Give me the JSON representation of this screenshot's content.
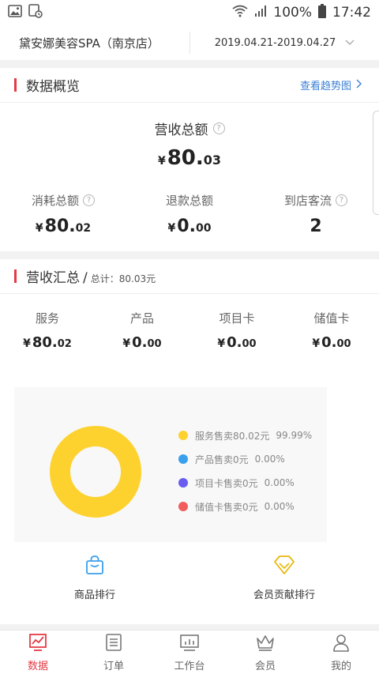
{
  "status_bar": {
    "battery": "100%",
    "time": "17:42"
  },
  "header": {
    "store_name": "黛安娜美容SPA（南京店）",
    "date_range": "2019.04.21-2019.04.27"
  },
  "overview": {
    "title": "数据概览",
    "trend_link": "查看趋势图",
    "revenue": {
      "label": "营收总额",
      "currency": "¥",
      "int": "80.",
      "dec": "03"
    },
    "consumption": {
      "label": "消耗总额",
      "currency": "¥",
      "int": "80.",
      "dec": "02"
    },
    "refund": {
      "label": "退款总额",
      "currency": "¥",
      "int": "0.",
      "dec": "00"
    },
    "visitors": {
      "label": "到店客流",
      "value": "2"
    }
  },
  "summary": {
    "title": "营收汇总",
    "slash": "/",
    "total_text": "总计：80.03元",
    "categories": [
      {
        "label": "服务",
        "currency": "¥",
        "int": "80.",
        "dec": "02"
      },
      {
        "label": "产品",
        "currency": "¥",
        "int": "0.",
        "dec": "00"
      },
      {
        "label": "项目卡",
        "currency": "¥",
        "int": "0.",
        "dec": "00"
      },
      {
        "label": "储值卡",
        "currency": "¥",
        "int": "0.",
        "dec": "00"
      }
    ]
  },
  "chart_data": {
    "type": "pie",
    "categories": [
      "服务售卖",
      "产品售卖",
      "项目卡售卖",
      "储值卡售卖"
    ],
    "values": [
      80.02,
      0,
      0,
      0
    ],
    "legend": [
      {
        "text": "服务售卖80.02元",
        "pct": "99.99%",
        "color": "#fdd22f"
      },
      {
        "text": "产品售卖0元",
        "pct": "0.00%",
        "color": "#3a9fed"
      },
      {
        "text": "项目卡售卖0元",
        "pct": "0.00%",
        "color": "#6a5cf0"
      },
      {
        "text": "储值卡售卖0元",
        "pct": "0.00%",
        "color": "#f25c5c"
      }
    ],
    "legend_position": "right"
  },
  "rankings": {
    "product": "商品排行",
    "member": "会员贡献排行"
  },
  "tabs": [
    {
      "label": "数据",
      "icon": "chart-icon"
    },
    {
      "label": "订单",
      "icon": "order-icon"
    },
    {
      "label": "工作台",
      "icon": "workbench-icon"
    },
    {
      "label": "会员",
      "icon": "crown-icon"
    },
    {
      "label": "我的",
      "icon": "user-icon"
    }
  ],
  "colors": {
    "accent": "#e53a45",
    "link": "#3a7fd5",
    "donut": "#fdd22f"
  }
}
